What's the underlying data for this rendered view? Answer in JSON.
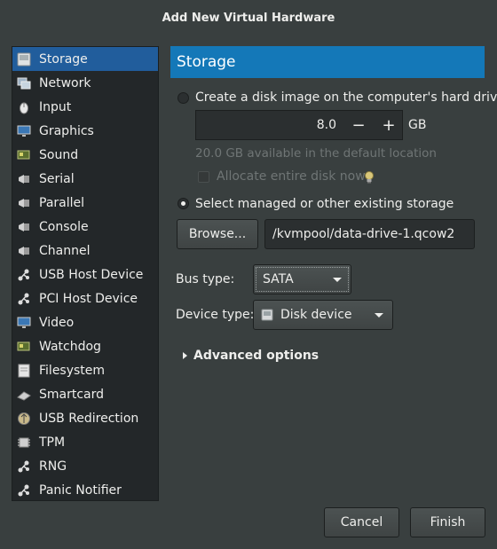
{
  "window": {
    "title": "Add New Virtual Hardware"
  },
  "sidebar": {
    "items": [
      {
        "label": "Storage",
        "icon": "storage-icon",
        "selected": true
      },
      {
        "label": "Network",
        "icon": "network-icon"
      },
      {
        "label": "Input",
        "icon": "mouse-icon"
      },
      {
        "label": "Graphics",
        "icon": "monitor-icon"
      },
      {
        "label": "Sound",
        "icon": "sound-card-icon"
      },
      {
        "label": "Serial",
        "icon": "serial-port-icon"
      },
      {
        "label": "Parallel",
        "icon": "parallel-port-icon"
      },
      {
        "label": "Console",
        "icon": "console-icon"
      },
      {
        "label": "Channel",
        "icon": "channel-icon"
      },
      {
        "label": "USB Host Device",
        "icon": "usb-icon"
      },
      {
        "label": "PCI Host Device",
        "icon": "pci-icon"
      },
      {
        "label": "Video",
        "icon": "video-icon"
      },
      {
        "label": "Watchdog",
        "icon": "watchdog-icon"
      },
      {
        "label": "Filesystem",
        "icon": "filesystem-icon"
      },
      {
        "label": "Smartcard",
        "icon": "smartcard-icon"
      },
      {
        "label": "USB Redirection",
        "icon": "usb-redirection-icon"
      },
      {
        "label": "TPM",
        "icon": "tpm-chip-icon"
      },
      {
        "label": "RNG",
        "icon": "rng-icon"
      },
      {
        "label": "Panic Notifier",
        "icon": "panic-notifier-icon"
      }
    ]
  },
  "storage": {
    "header": "Storage",
    "create_label": "Create a disk image on the computer's hard drive",
    "size_value": "8.0",
    "size_unit": "GB",
    "minus": "−",
    "plus": "+",
    "available_text": "20.0 GB available in the default location",
    "allocate_label": "Allocate entire disk now",
    "select_label": "Select managed or other existing storage",
    "browse_label": "Browse...",
    "path_value": "/kvmpool/data-drive-1.qcow2",
    "bus_label": "Bus type:",
    "bus_value": "SATA",
    "device_label": "Device type:",
    "device_value": "Disk device",
    "advanced_label": "Advanced options"
  },
  "footer": {
    "cancel_label": "Cancel",
    "finish_label": "Finish"
  },
  "colors": {
    "accent": "#1478b8",
    "selection": "#215d9c",
    "background": "#393f3f"
  }
}
